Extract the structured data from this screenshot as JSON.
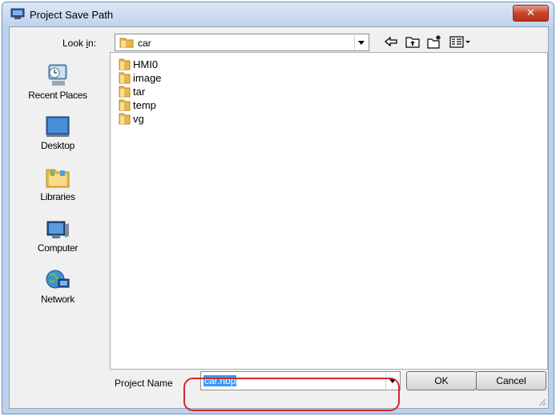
{
  "window": {
    "title": "Project Save Path",
    "close_label": "✕"
  },
  "lookin": {
    "label_prefix": "Look ",
    "label_underlined": "i",
    "label_suffix": "n:",
    "value": "car"
  },
  "toolbar": {
    "icons": [
      "back-icon",
      "up-folder-icon",
      "new-folder-icon",
      "view-menu-icon"
    ]
  },
  "places": [
    {
      "label": "Recent Places",
      "icon": "recent-places-icon"
    },
    {
      "label": "Desktop",
      "icon": "desktop-icon"
    },
    {
      "label": "Libraries",
      "icon": "libraries-icon"
    },
    {
      "label": "Computer",
      "icon": "computer-icon"
    },
    {
      "label": "Network",
      "icon": "network-icon"
    }
  ],
  "files": [
    "HMI0",
    "image",
    "tar",
    "temp",
    "vg"
  ],
  "project_name": {
    "label": "Project Name",
    "value": "car.nbp"
  },
  "buttons": {
    "ok": "OK",
    "cancel": "Cancel"
  },
  "colors": {
    "highlight": "#d7262e",
    "selection": "#3399ff",
    "folder": "#e7b84b"
  }
}
